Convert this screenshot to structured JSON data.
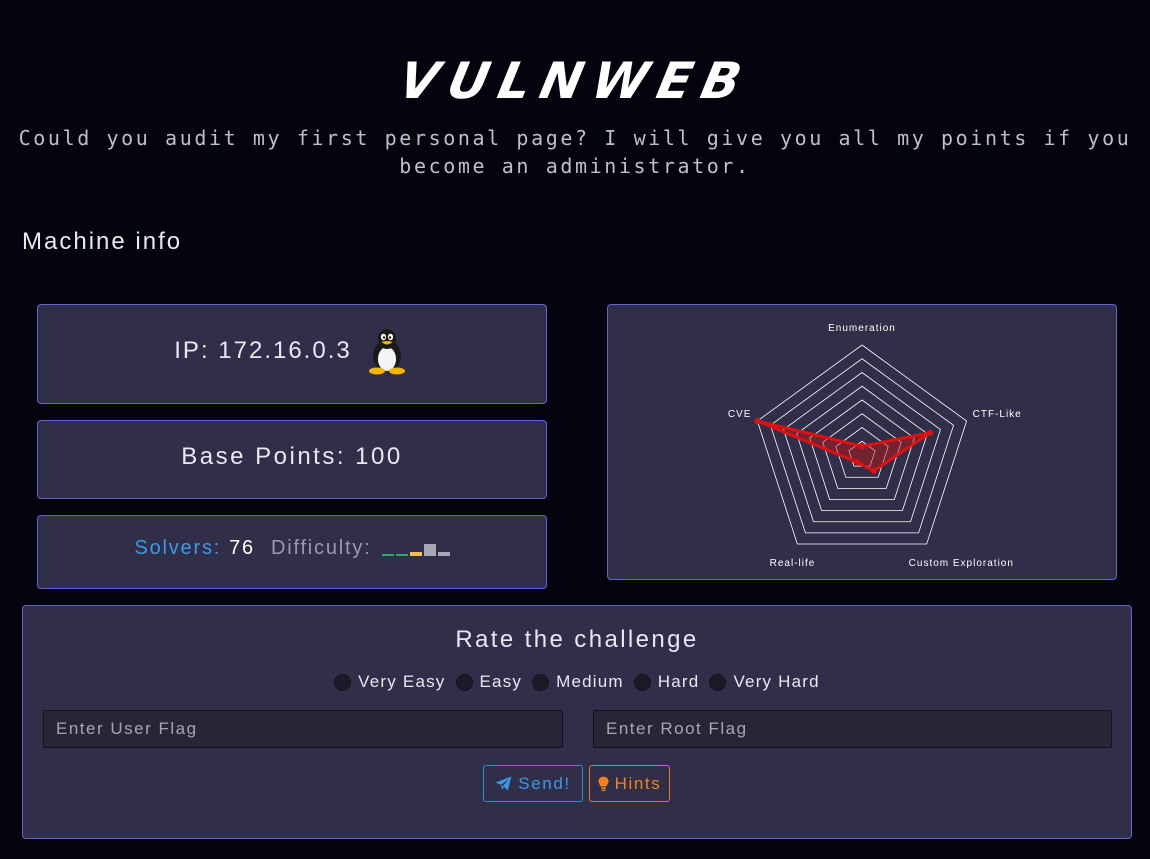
{
  "header": {
    "logo": "VULNWEB",
    "subtitle": "Could you audit my first personal page? I will give you all my points if you become an administrator."
  },
  "machine_info": {
    "title": "Machine info",
    "ip_text": "IP: 172.16.0.3",
    "os_icon": "linux-tux-icon",
    "base_points_text": "Base Points: 100",
    "solvers_label": "Solvers:",
    "solvers_value": "76",
    "difficulty_label": "Difficulty:",
    "difficulty_bars": [
      {
        "level": 0.15,
        "color": "#2ea86b"
      },
      {
        "level": 0.08,
        "color": "#2ea86b"
      },
      {
        "level": 0.25,
        "color": "#f2c14e"
      },
      {
        "level": 0.85,
        "color": "#a8a8b4"
      },
      {
        "level": 0.3,
        "color": "#a8a8b4"
      }
    ]
  },
  "radar": {
    "axes": [
      "Enumeration",
      "CTF-Like",
      "Custom Exploration",
      "Real-life",
      "CVE"
    ],
    "values": [
      0.08,
      0.65,
      0.18,
      0.08,
      1.0
    ],
    "line_color": "#e01010"
  },
  "rating": {
    "title": "Rate the challenge",
    "options": [
      "Very Easy",
      "Easy",
      "Medium",
      "Hard",
      "Very Hard"
    ],
    "user_flag_placeholder": "Enter User Flag",
    "root_flag_placeholder": "Enter Root Flag",
    "send_label": "Send!",
    "send_icon": "paper-plane-icon",
    "hints_label": "Hints",
    "hints_icon": "lightbulb-icon"
  },
  "colors": {
    "background": "#03040d",
    "card": "#302e48",
    "card_border": "#6a5fd0",
    "accent_blue": "#3b9ae6",
    "accent_orange": "#f0841c"
  }
}
